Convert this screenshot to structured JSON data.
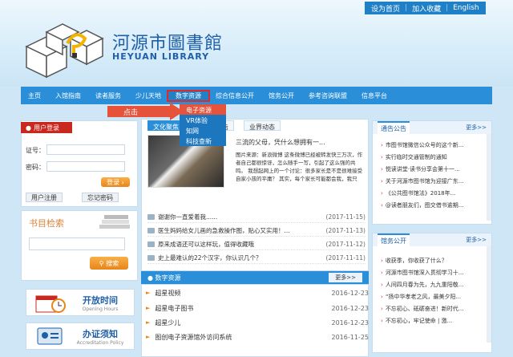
{
  "top_links": [
    "设为首页",
    "加入收藏",
    "English"
  ],
  "logo": {
    "cn": "河源市圖書館",
    "en": "HEYUAN LIBRARY"
  },
  "nav": [
    "主页",
    "入馆指南",
    "读者服务",
    "少儿天地",
    "数字资源",
    "综合信息公开",
    "馆务公开",
    "参考咨询联盟",
    "信息平台"
  ],
  "dropdown": [
    "电子资源",
    "VR体验",
    "知网",
    "科技查新"
  ],
  "click_hint": "点击",
  "login": {
    "title": "用户登录",
    "card_label": "证号：",
    "password_label": "密码：",
    "login_btn": "登录",
    "register_btn": "用户注册",
    "forgot_btn": "忘记密码"
  },
  "book_search": {
    "title": "书目检索",
    "button": "搜索"
  },
  "cards": [
    {
      "title": "开放时间",
      "sub": "Opening Hours"
    },
    {
      "title": "办证须知",
      "sub": "Accreditation Policy"
    }
  ],
  "tabs": [
    "文化聚焦",
    "公告",
    "业界动态"
  ],
  "feature": {
    "title": "三流的父母，凭什么想拥有一...",
    "body": "图片来源：新浪微博    这条微博已经被转发快三万次，作者自己都很惊讶，怎么随手一写，引起了这么强的共鸣。    我想起网上的一个讨论：很多家长是不是很难接受自家小孩的平庸？    其实，每个家长可能都会我，我只"
  },
  "news": [
    {
      "title": "谢谢你一直爱着我......",
      "date": "(2017-11-15)"
    },
    {
      "title": "医生妈妈给女儿画的急救操作图，贴心又实用！...",
      "date": "(2017-11-13)"
    },
    {
      "title": "原来成语还可以这样玩，值得收藏哦",
      "date": "(2017-11-12)"
    },
    {
      "title": "史上最难认的22个汉字，你认识几个？",
      "date": "(2017-11-11)"
    }
  ],
  "digital": {
    "title": "数字资源",
    "more": "更多>>",
    "items": [
      {
        "title": "超星视频",
        "date": "2016-12-23"
      },
      {
        "title": "超星电子图书",
        "date": "2016-12-23"
      },
      {
        "title": "超星少儿",
        "date": "2016-12-23"
      },
      {
        "title": "图创电子资源馆外访问系统",
        "date": "2016-11-25"
      }
    ]
  },
  "notices": {
    "title": "通告公告",
    "more": "更多>>",
    "items": [
      "市图书馆微信公众号的这个新...",
      "实行临时交通管制的通知",
      "悦读讲堂·读书分享会第十一...",
      "关于河源市图书馆为迎接广东...",
      "《公共图书馆法》2018年...",
      "@读者朋友们，图交借书逾期..."
    ]
  },
  "affairs": {
    "title": "馆务公开",
    "more": "更多>>",
    "items": [
      "收获季，你收获了什么？",
      "河源市图书馆深入贯彻学习十...",
      "人间四月春为先，九九重阳敬...",
      "“扬中华孝老之风，最美夕阳...",
      "不忘初心、砥砺奋进！新时代...",
      "不忘初心，牢记使命 | 激..."
    ]
  },
  "colors": {
    "nav": "#2a8fd8",
    "login_head": "#c8281d",
    "accent_orange": "#e8851a",
    "highlight_red": "#e02a2a"
  }
}
